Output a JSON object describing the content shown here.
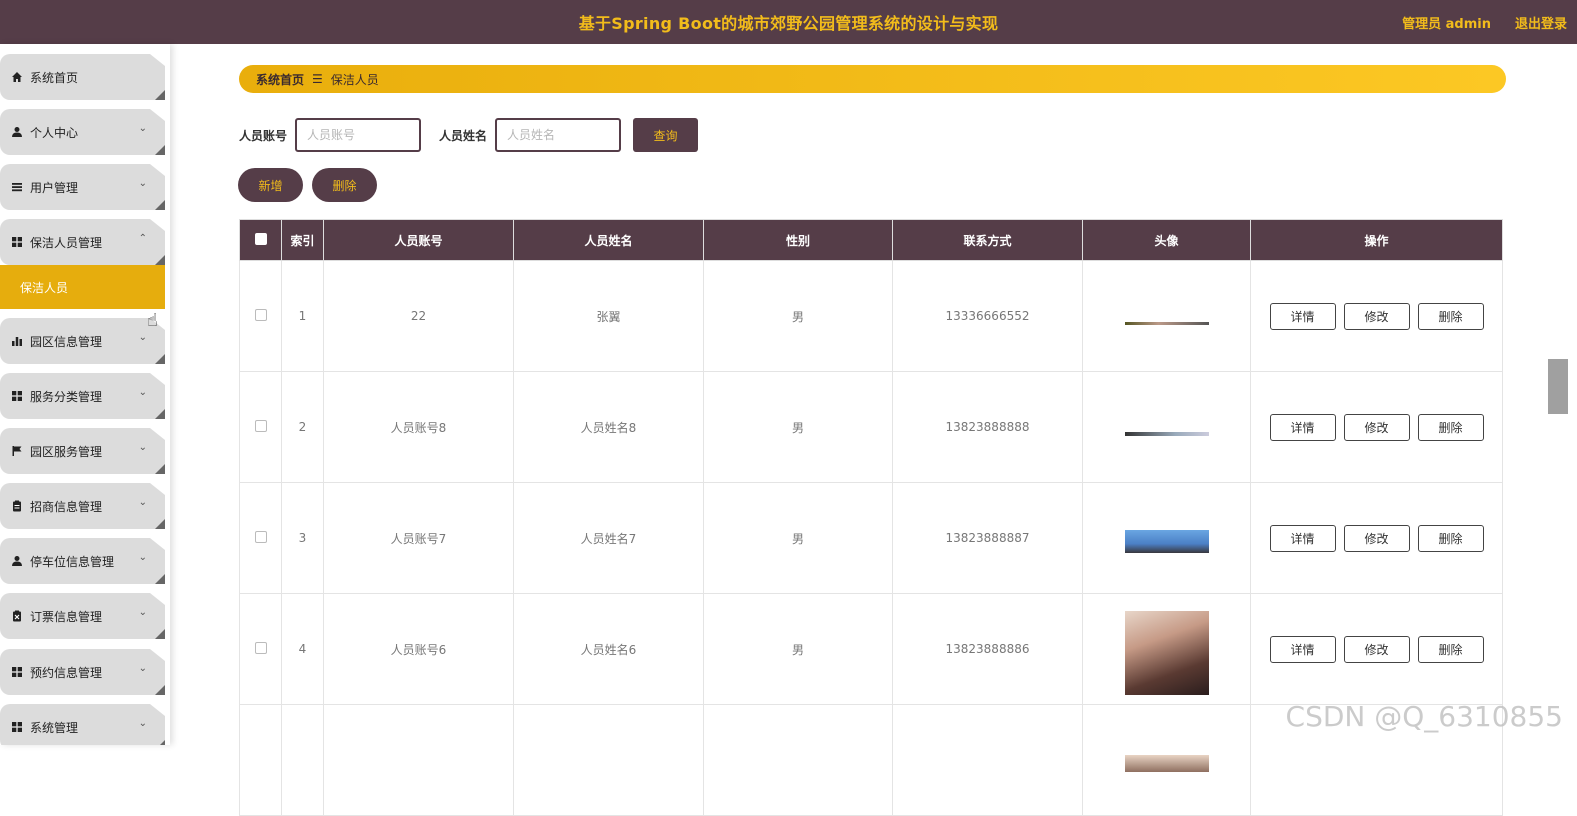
{
  "header": {
    "title": "基于Spring Boot的城市郊野公园管理系统的设计与实现",
    "admin": "管理员 admin",
    "logout": "退出登录"
  },
  "sidebar": {
    "items": [
      {
        "label": "系统首页",
        "icon": "home-icon",
        "chevron": ""
      },
      {
        "label": "个人中心",
        "icon": "user-icon",
        "chevron": "down"
      },
      {
        "label": "用户管理",
        "icon": "list-icon",
        "chevron": "down"
      },
      {
        "label": "保洁人员管理",
        "icon": "grid-icon",
        "chevron": "up"
      },
      {
        "label": "园区信息管理",
        "icon": "bar-chart-icon",
        "chevron": "down"
      },
      {
        "label": "服务分类管理",
        "icon": "grid-icon",
        "chevron": "down"
      },
      {
        "label": "园区服务管理",
        "icon": "flag-icon",
        "chevron": "down"
      },
      {
        "label": "招商信息管理",
        "icon": "clipboard-icon",
        "chevron": "down"
      },
      {
        "label": "停车位信息管理",
        "icon": "user-icon",
        "chevron": "down"
      },
      {
        "label": "订票信息管理",
        "icon": "clipboard-x-icon",
        "chevron": "down"
      },
      {
        "label": "预约信息管理",
        "icon": "grid-icon",
        "chevron": "down"
      },
      {
        "label": "系统管理",
        "icon": "grid-icon",
        "chevron": "down"
      }
    ],
    "active_sub": "保洁人员"
  },
  "breadcrumb": {
    "home": "系统首页",
    "sep": "☰",
    "current": "保洁人员"
  },
  "search": {
    "account_label": "人员账号",
    "account_placeholder": "人员账号",
    "name_label": "人员姓名",
    "name_placeholder": "人员姓名",
    "query": "查询"
  },
  "actions": {
    "add": "新增",
    "delete": "删除"
  },
  "table": {
    "columns": [
      "索引",
      "人员账号",
      "人员姓名",
      "性别",
      "联系方式",
      "头像",
      "操作"
    ],
    "rows": [
      {
        "index": "1",
        "account": "22",
        "name": "张翼",
        "gender": "男",
        "phone": "13336666552"
      },
      {
        "index": "2",
        "account": "人员账号8",
        "name": "人员姓名8",
        "gender": "男",
        "phone": "13823888888"
      },
      {
        "index": "3",
        "account": "人员账号7",
        "name": "人员姓名7",
        "gender": "男",
        "phone": "13823888887"
      },
      {
        "index": "4",
        "account": "人员账号6",
        "name": "人员姓名6",
        "gender": "男",
        "phone": "13823888886"
      },
      {
        "index": "",
        "account": "",
        "name": "",
        "gender": "",
        "phone": ""
      }
    ],
    "op_detail": "详情",
    "op_edit": "修改",
    "op_delete": "删除"
  },
  "watermark": "CSDN @Q_6310855",
  "colors": {
    "primary": "#553d48",
    "accent": "#f2bc1b",
    "active": "#e6ad0d"
  }
}
